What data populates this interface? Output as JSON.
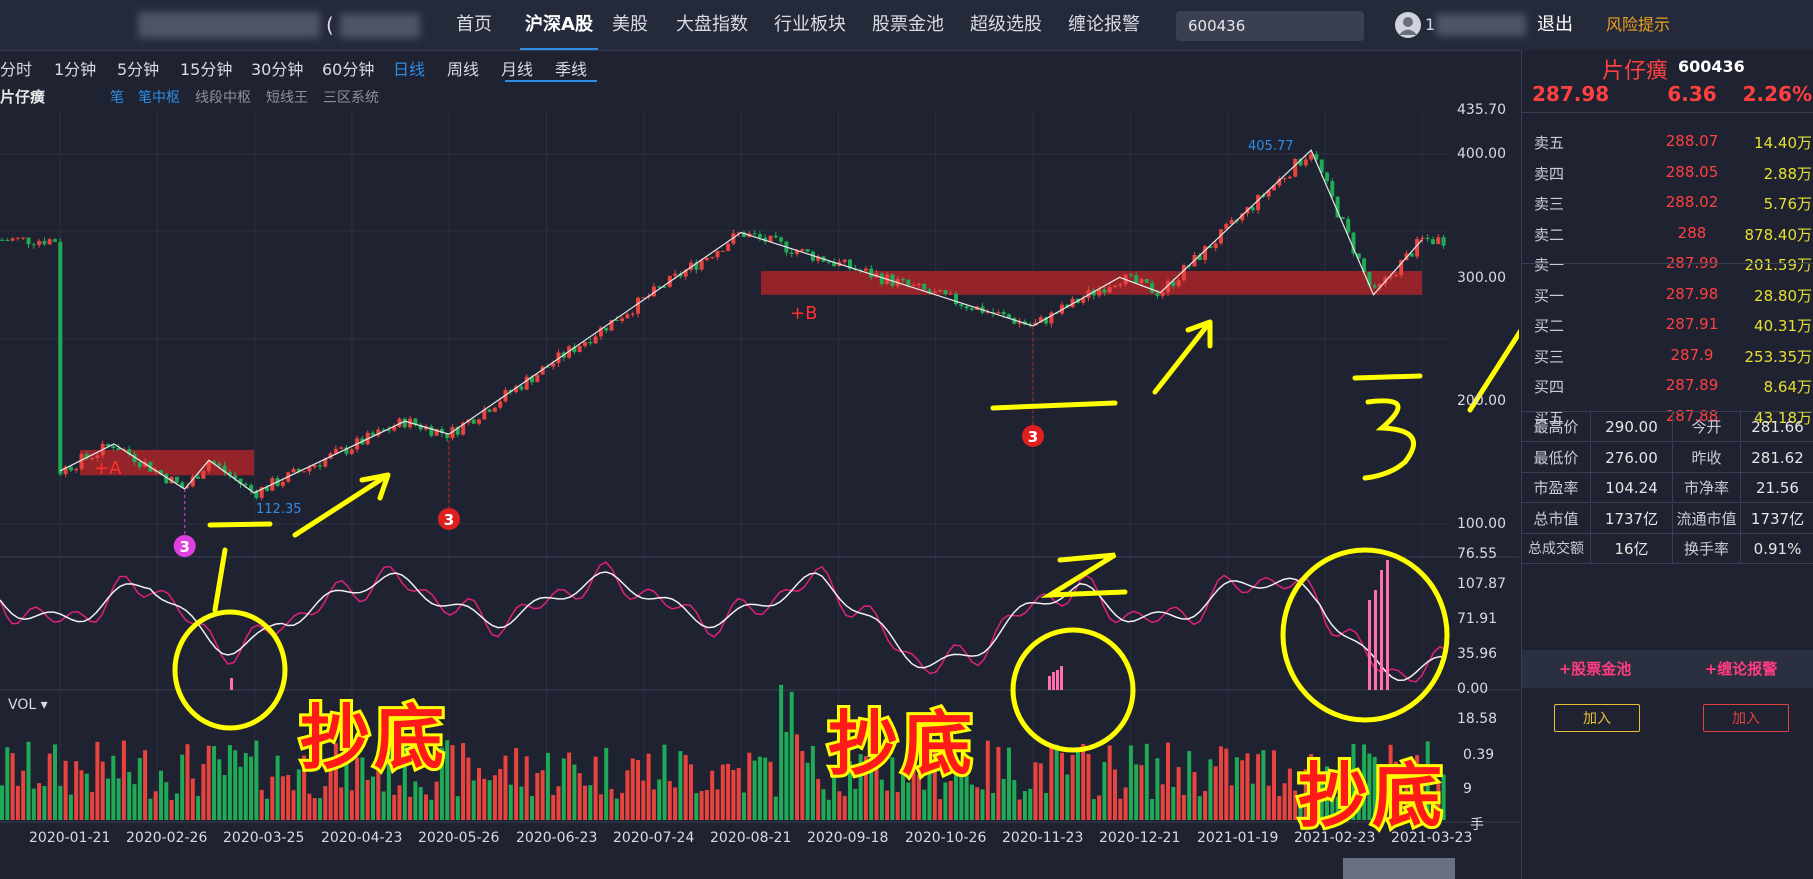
{
  "nav": {
    "items": [
      "首页",
      "沪深A股",
      "美股",
      "大盘指数",
      "行业板块",
      "股票金池",
      "超级选股",
      "缠论报警"
    ],
    "active": "沪深A股",
    "search_value": "600436",
    "user_prefix": "1",
    "bracket": "(",
    "logout": "退出",
    "risk": "风险提示"
  },
  "periods": {
    "items": [
      "分时",
      "1分钟",
      "5分钟",
      "15分钟",
      "30分钟",
      "60分钟",
      "日线",
      "周线",
      "月线",
      "季线"
    ],
    "active": "日线"
  },
  "chart_toolbar": {
    "stock_name": "片仔癀",
    "tools": [
      "笔",
      "笔中枢",
      "线段中枢",
      "短线王",
      "三区系统"
    ]
  },
  "vol_label": "VOL",
  "chart_data": [
    {
      "type": "line",
      "yaxis_ticks": [
        "435.70",
        "400.00",
        "300.00",
        "200.00",
        "100.00",
        "76.55"
      ],
      "yaxis_scale": "log",
      "xaxis_dates": [
        "2020-01-21",
        "2020-02-26",
        "2020-03-25",
        "2020-04-23",
        "2020-05-26",
        "2020-06-23",
        "2020-07-24",
        "2020-08-21",
        "2020-09-18",
        "2020-10-26",
        "2020-11-23",
        "2020-12-21",
        "2021-01-19",
        "2021-02-23",
        "2021-03-23"
      ],
      "bi_line": [
        {
          "x": "2020-01-21",
          "y": 122
        },
        {
          "x": "2020-02-10",
          "y": 135
        },
        {
          "x": "2020-03-05",
          "y": 114
        },
        {
          "x": "2020-03-12",
          "y": 127
        },
        {
          "x": "2020-03-25",
          "y": 112.35
        },
        {
          "x": "2020-05-11",
          "y": 147
        },
        {
          "x": "2020-05-26",
          "y": 140
        },
        {
          "x": "2020-08-21",
          "y": 298
        },
        {
          "x": "2020-11-23",
          "y": 210
        },
        {
          "x": "2020-12-18",
          "y": 252
        },
        {
          "x": "2020-12-30",
          "y": 238
        },
        {
          "x": "2021-02-18",
          "y": 405.77
        },
        {
          "x": "2021-03-09",
          "y": 236
        },
        {
          "x": "2021-03-23",
          "y": 290
        }
      ],
      "zhongshu": [
        {
          "x0": "2020-01-21",
          "x1": "2020-03-25",
          "y0": 120,
          "y1": 132,
          "label": "+A"
        },
        {
          "x0": "2020-08-21",
          "x1": "2021-03-23",
          "y0": 236,
          "y1": 258,
          "label": "+B"
        }
      ],
      "price_labels": [
        "405.77",
        "112.35"
      ],
      "buy_markers": [
        {
          "x": "2020-03-05",
          "label": "3"
        },
        {
          "x": "2020-05-26",
          "label": "3"
        },
        {
          "x": "2020-11-23",
          "label": "3"
        }
      ]
    },
    {
      "type": "line",
      "yaxis_ticks": [
        "107.87",
        "71.91",
        "35.96",
        "0.00"
      ],
      "series": []
    },
    {
      "type": "bar",
      "yaxis_ticks": [
        "18.58",
        "0.39",
        "9"
      ],
      "unit": "手",
      "values": []
    }
  ],
  "panel": {
    "name": "片仔癀",
    "code": "600436",
    "price": "287.98",
    "change": "6.36",
    "change_pct": "2.26%",
    "orderbook": [
      {
        "label": "卖五",
        "price": "288.07",
        "vol": "14.40万"
      },
      {
        "label": "卖四",
        "price": "288.05",
        "vol": "2.88万"
      },
      {
        "label": "卖三",
        "price": "288.02",
        "vol": "5.76万"
      },
      {
        "label": "卖二",
        "price": "288",
        "vol": "878.40万"
      },
      {
        "label": "卖一",
        "price": "287.99",
        "vol": "201.59万"
      },
      {
        "label": "买一",
        "price": "287.98",
        "vol": "28.80万"
      },
      {
        "label": "买二",
        "price": "287.91",
        "vol": "40.31万"
      },
      {
        "label": "买三",
        "price": "287.9",
        "vol": "253.35万"
      },
      {
        "label": "买四",
        "price": "287.89",
        "vol": "8.64万"
      },
      {
        "label": "买五",
        "price": "287.88",
        "vol": "43.18万"
      }
    ],
    "stats": [
      [
        "最高价",
        "290.00",
        "今开",
        "281.66"
      ],
      [
        "最低价",
        "276.00",
        "昨收",
        "281.62"
      ],
      [
        "市盈率",
        "104.24",
        "市净率",
        "21.56"
      ],
      [
        "总市值",
        "1737亿",
        "流通市值",
        "1737亿"
      ],
      [
        "总成交额",
        "16亿",
        "换手率",
        "0.91%"
      ]
    ],
    "pool_label": "+股票金池",
    "alert_label": "+缠论报警",
    "add_label": "加入",
    "add_label2": "加入"
  },
  "annotations": {
    "note1": "抄底",
    "note2": "抄底",
    "note3": "抄底",
    "num1": "1",
    "num2": "2",
    "num3": "3"
  },
  "colors": {
    "bg": "#1f2230",
    "up": "#e8433f",
    "down": "#1faa55",
    "accent": "#2f8de4",
    "zhongshu": "#a1252a",
    "annotation": "#ffff00"
  }
}
